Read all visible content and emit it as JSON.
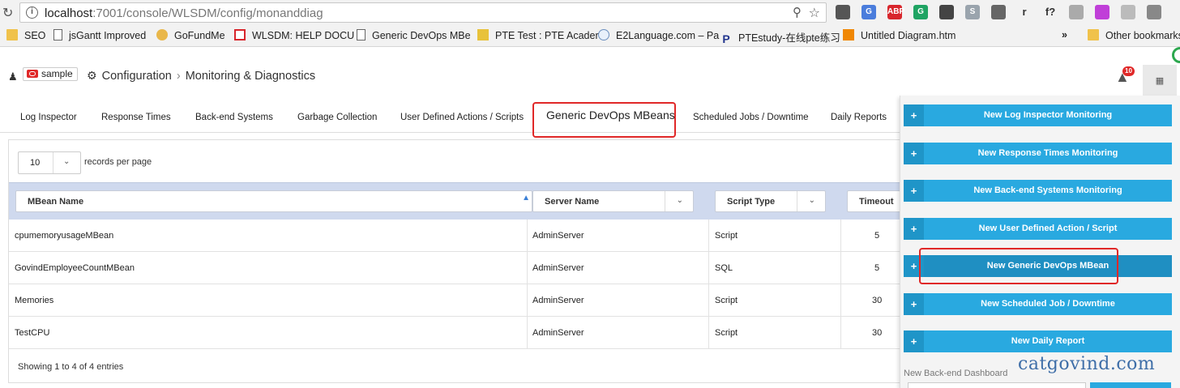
{
  "browser": {
    "url_host": "localhost",
    "url_path": ":7001/console/WLSDM/config/monanddiag",
    "extensions": [
      {
        "label": "",
        "color": "#555555"
      },
      {
        "label": "G",
        "color": "#4a7ddc"
      },
      {
        "label": "ABP",
        "color": "#d8262c"
      },
      {
        "label": "G",
        "color": "#1fa463"
      },
      {
        "label": "",
        "color": "#444444"
      },
      {
        "label": "S",
        "color": "#9aa4ad"
      },
      {
        "label": "",
        "color": "#666666"
      },
      {
        "label": "r",
        "color": "#f2f2f2"
      },
      {
        "label": "f?",
        "color": "#f2f2f2"
      },
      {
        "label": "",
        "color": "#aaaaaa"
      },
      {
        "label": "",
        "color": "#c03fd8"
      },
      {
        "label": "",
        "color": "#bbbbbb"
      },
      {
        "label": "",
        "color": "#888888"
      }
    ],
    "bookmarks": [
      "SEO",
      "jsGantt Improved",
      "GoFundMe",
      "WLSDM: HELP DOCU",
      "Generic DevOps MBe",
      "PTE Test : PTE Acader",
      "E2Language.com – Pa",
      "PTEstudy-在线pte练习",
      "Untitled Diagram.htm"
    ],
    "overflow": "»",
    "other_bookmarks": "Other bookmarks"
  },
  "header": {
    "domain_badge": "sample",
    "crumb_config": "Configuration",
    "crumb_sep": "›",
    "crumb_page": "Monitoring & Diagnostics",
    "alert_count": "10"
  },
  "tabs": [
    {
      "label": "Log Inspector"
    },
    {
      "label": "Response Times"
    },
    {
      "label": "Back-end Systems"
    },
    {
      "label": "Garbage Collection"
    },
    {
      "label": "User Defined Actions / Scripts"
    },
    {
      "label": "Generic DevOps MBeans",
      "active": true
    },
    {
      "label": "Scheduled Jobs / Downtime"
    },
    {
      "label": "Daily Reports"
    }
  ],
  "table": {
    "page_length": "10",
    "length_label": "records per page",
    "columns": [
      "MBean Name",
      "Server Name",
      "Script Type",
      "Timeout"
    ],
    "rows": [
      [
        "cpumemoryusageMBean",
        "AdminServer",
        "Script",
        "5"
      ],
      [
        "GovindEmployeeCountMBean",
        "AdminServer",
        "SQL",
        "5"
      ],
      [
        "Memories",
        "AdminServer",
        "Script",
        "30"
      ],
      [
        "TestCPU",
        "AdminServer",
        "Script",
        "30"
      ]
    ],
    "info": "Showing 1 to 4 of 4 entries"
  },
  "menu": {
    "plus": "+",
    "items": [
      {
        "label": "New Log Inspector Monitoring"
      },
      {
        "label": "New Response Times Monitoring"
      },
      {
        "label": "New Back-end Systems Monitoring"
      },
      {
        "label": "New User Defined Action / Script"
      },
      {
        "label": "New Generic DevOps MBean",
        "selected": true
      },
      {
        "label": "New Scheduled Job / Downtime"
      },
      {
        "label": "New Daily Report"
      }
    ],
    "dashboard_label": "New Back-end Dashboard"
  },
  "watermark": "catgovind.com",
  "colors": {
    "accent": "#29a9e0",
    "highlight": "#e02828",
    "table_header": "#cfd9ee"
  }
}
